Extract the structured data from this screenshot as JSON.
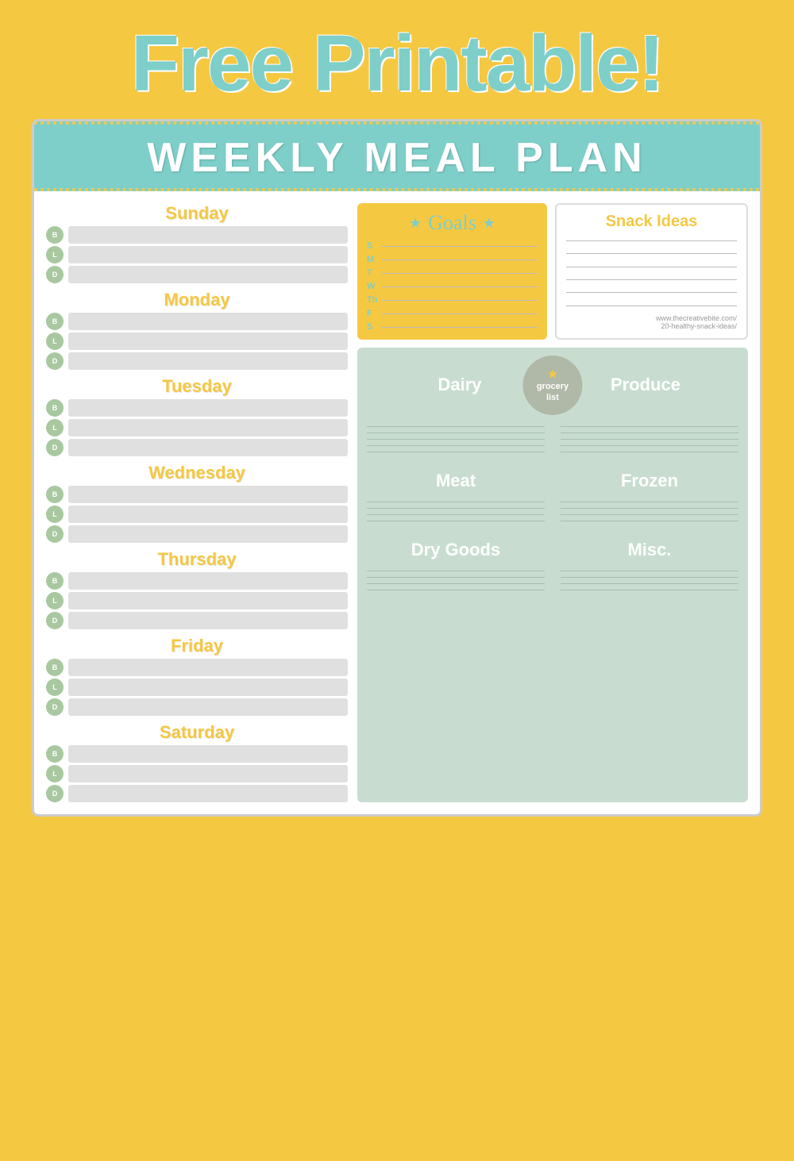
{
  "page": {
    "title": "Free Printable!",
    "background_color": "#f5c842",
    "header": {
      "title": "WEEKLY MEAL PLAN",
      "bg_color": "#7ecfc9"
    }
  },
  "days": [
    {
      "name": "Sunday",
      "meals": [
        "B",
        "L",
        "D"
      ]
    },
    {
      "name": "Monday",
      "meals": [
        "B",
        "L",
        "D"
      ]
    },
    {
      "name": "Tuesday",
      "meals": [
        "B",
        "L",
        "D"
      ]
    },
    {
      "name": "Wednesday",
      "meals": [
        "B",
        "L",
        "D"
      ]
    },
    {
      "name": "Thursday",
      "meals": [
        "B",
        "L",
        "D"
      ]
    },
    {
      "name": "Friday",
      "meals": [
        "B",
        "L",
        "D"
      ]
    },
    {
      "name": "Saturday",
      "meals": [
        "B",
        "L",
        "D"
      ]
    }
  ],
  "goals": {
    "title": "Goals",
    "day_letters": [
      "S",
      "M",
      "T",
      "W",
      "Th",
      "F",
      "S"
    ]
  },
  "snack_ideas": {
    "title": "Snack Ideas",
    "url_line1": "www.thecreativebite.com/",
    "url_line2": "20-healthy-snack-ideas/"
  },
  "grocery": {
    "badge_text": "grocery\nlist",
    "categories": [
      {
        "name": "Dairy",
        "lines": 5
      },
      {
        "name": "Produce",
        "lines": 5
      },
      {
        "name": "Meat",
        "lines": 4
      },
      {
        "name": "Frozen",
        "lines": 4
      },
      {
        "name": "Dry Goods",
        "lines": 4
      },
      {
        "name": "Misc.",
        "lines": 4
      }
    ]
  }
}
